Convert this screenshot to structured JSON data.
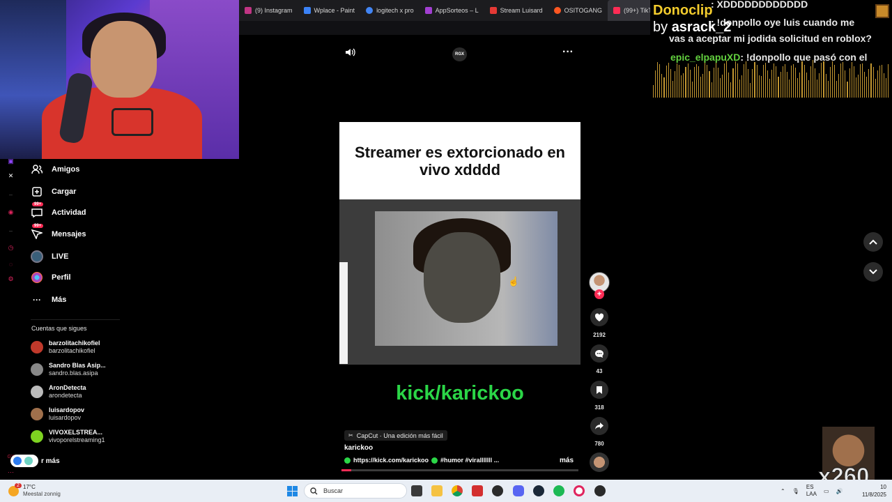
{
  "browser": {
    "tabs": [
      {
        "label": "(9) Instagram",
        "color": "#c13584"
      },
      {
        "label": "Wplace - Paint",
        "color": "#3b82f6"
      },
      {
        "label": "logitech x pro",
        "color": "#4285f4"
      },
      {
        "label": "AppSorteos – L",
        "color": "#a23fd1"
      },
      {
        "label": "Stream Luisard",
        "color": "#e53935"
      },
      {
        "label": "OSITOGANG",
        "color": "#ff5722"
      },
      {
        "label": "(99+) TikTok -",
        "color": "#fe2c55"
      }
    ]
  },
  "sidebar": {
    "items": [
      {
        "label": "Amigos",
        "icon": "friends-icon"
      },
      {
        "label": "Cargar",
        "icon": "upload-icon"
      },
      {
        "label": "Actividad",
        "icon": "activity-icon",
        "badge": "99+"
      },
      {
        "label": "Mensajes",
        "icon": "messages-icon",
        "badge": "99+"
      },
      {
        "label": "LIVE",
        "icon": "live-icon"
      },
      {
        "label": "Perfil",
        "icon": "profile-icon"
      },
      {
        "label": "Más",
        "icon": "more-icon"
      }
    ],
    "following_title": "Cuentas que sigues",
    "accounts": [
      {
        "name": "barzolitachikofiel",
        "handle": "barzolitachikofiel",
        "color": "#c0392b"
      },
      {
        "name": "Sandro Blas Asip...",
        "handle": "sandro.blas.asipa",
        "color": "#888888"
      },
      {
        "name": "AronDetecta",
        "handle": "arondetecta",
        "color": "#bbbbbb"
      },
      {
        "name": "luisardopov",
        "handle": "luisardopov",
        "color": "#a0704c"
      },
      {
        "name": "VIVOXELSTREA...",
        "handle": "vivoporelstreaming1",
        "color": "#7ed321"
      }
    ],
    "see_more": "r más"
  },
  "video": {
    "badge": "RGX",
    "caption": "Streamer es extorcionado en vivo xdddd",
    "overlay_text": "kick/karickoo",
    "capcut_label": "CapCut · Una edición más fácil",
    "author": "karickoo",
    "description_link": "https://kick.com/karickoo",
    "hashtags": "#humor  #viralllllll  ...",
    "more": "más",
    "progress": 0.04
  },
  "actions": {
    "likes": "2192",
    "comments": "43",
    "saves": "318",
    "shares": "780"
  },
  "overlay": {
    "title": "Donoclip",
    "by": "by",
    "by_user": "asrack_2",
    "chat": [
      {
        "user": "",
        "text": ": XDDDDDDDDDDDD"
      },
      {
        "user": "",
        "text": ": !donpollo oye luis cuando me"
      },
      {
        "user": "",
        "text": "vas a aceptar mi jodida solicitud en roblox?"
      },
      {
        "user": "epic_elpapuXD",
        "text": ": !donpollo que pasó con el"
      }
    ],
    "multiplier": "x260"
  },
  "taskbar": {
    "weather_badge": "2",
    "temp": "17°C",
    "condition": "Meestal zonnig",
    "search_placeholder": "Buscar",
    "lang": "ES",
    "lang2": "LAA",
    "time": "10",
    "date": "11/8/2025"
  }
}
